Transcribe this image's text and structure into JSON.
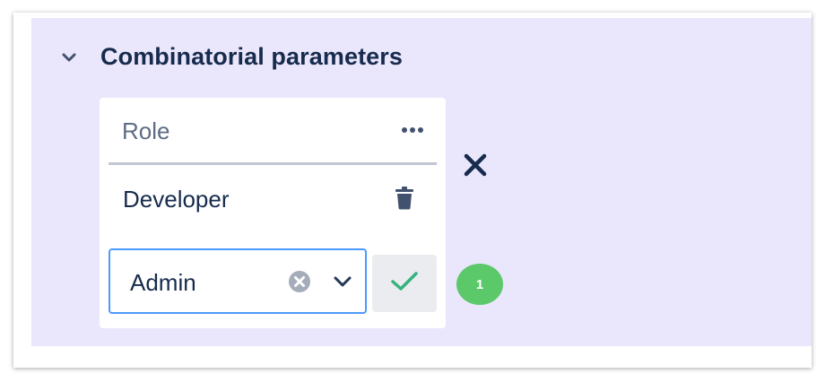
{
  "section": {
    "title": "Combinatorial parameters",
    "toggle_icon": "chevron-down-icon"
  },
  "parameter_card": {
    "title": "Role",
    "more_icon": "more-horizontal-icon",
    "values": [
      {
        "label": "Developer",
        "delete_icon": "trash-icon"
      }
    ],
    "new_value": {
      "selected": "Admin",
      "clear_icon": "clear-circle-icon",
      "dropdown_icon": "chevron-down-icon",
      "confirm_icon": "check-icon"
    }
  },
  "remove_icon": "close-icon",
  "step_badge": "1",
  "colors": {
    "panel_bg": "#eae6fb",
    "title_text": "#172b4d",
    "muted_text": "#5e6c84",
    "focus_border": "#4c9aff",
    "confirm_check": "#36b37e",
    "badge_bg": "#5bc86a"
  }
}
